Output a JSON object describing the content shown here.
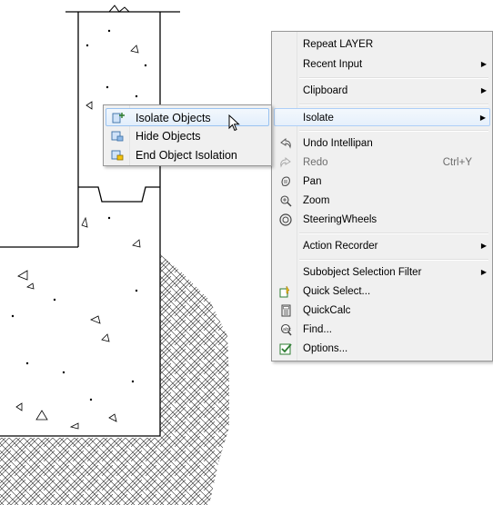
{
  "context_menu": {
    "items": [
      {
        "label": "Repeat LAYER"
      },
      {
        "label": "Recent Input"
      },
      {
        "label": "Clipboard"
      },
      {
        "label": "Isolate"
      },
      {
        "label": "Undo Intellipan"
      },
      {
        "label": "Redo",
        "shortcut": "Ctrl+Y"
      },
      {
        "label": "Pan"
      },
      {
        "label": "Zoom"
      },
      {
        "label": "SteeringWheels"
      },
      {
        "label": "Action Recorder"
      },
      {
        "label": "Subobject Selection Filter"
      },
      {
        "label": "Quick Select..."
      },
      {
        "label": "QuickCalc"
      },
      {
        "label": "Find..."
      },
      {
        "label": "Options..."
      }
    ]
  },
  "isolate_submenu": {
    "items": [
      {
        "label": "Isolate Objects"
      },
      {
        "label": "Hide Objects"
      },
      {
        "label": "End Object Isolation"
      }
    ]
  },
  "colors": {
    "menu_bg": "#f0f0f0",
    "highlight_border": "#aecff7",
    "disabled_text": "#6d6d6d"
  }
}
